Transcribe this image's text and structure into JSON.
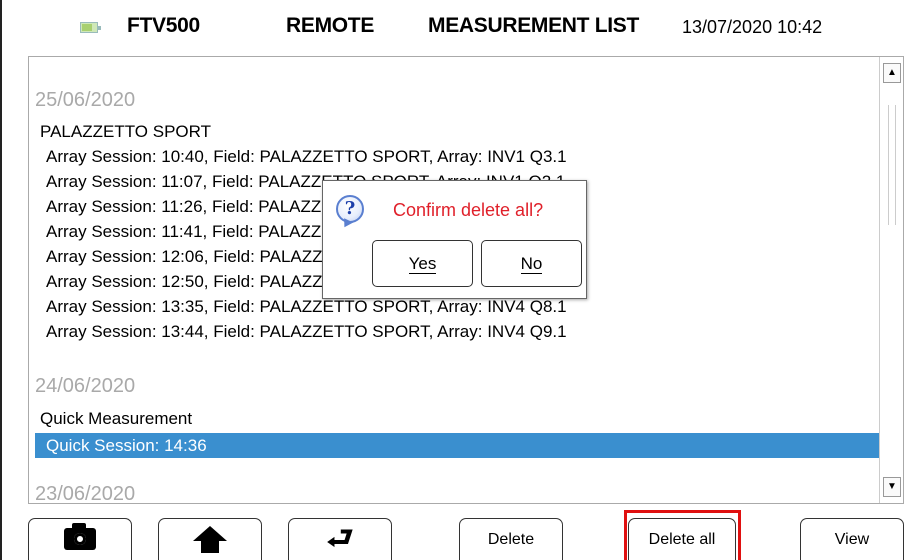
{
  "header": {
    "battery_icon": "battery-icon",
    "device": "FTV500",
    "mode": "REMOTE",
    "title": "MEASUREMENT LIST",
    "datetime": "13/07/2020 10:42"
  },
  "list": {
    "date1": "25/06/2020",
    "group1": "PALAZZETTO SPORT",
    "items1": [
      "Array Session: 10:40, Field: PALAZZETTO SPORT, Array: INV1 Q3.1",
      "Array Session: 11:07, Field: PALAZZETTO SPORT, Array: INV1 Q2.1",
      "Array Session: 11:26, Field: PALAZZETTO SPORT, Array: INV2 Q4.1",
      "Array Session: 11:41, Field: PALAZZETTO SPORT, Array: INV2 Q5.1",
      "Array Session: 12:06, Field: PALAZZETTO SPORT, Array: INV3 Q6.1",
      "Array Session: 12:50, Field: PALAZZETTO SPORT, Array: INV3 Q7.1",
      "Array Session: 13:35, Field: PALAZZETTO SPORT, Array: INV4 Q8.1",
      "Array Session: 13:44, Field: PALAZZETTO SPORT, Array: INV4 Q9.1"
    ],
    "date2": "24/06/2020",
    "group2": "Quick Measurement",
    "selected_item": "Quick Session: 14:36",
    "date3": "23/06/2020"
  },
  "dialog": {
    "icon": "question-icon",
    "message": "Confirm delete all?",
    "yes_label": "Yes",
    "no_label": "No"
  },
  "toolbar": {
    "camera_icon": "camera-icon",
    "home_icon": "home-icon",
    "back_icon": "back-arrow-icon",
    "delete_label": "Delete",
    "delete_all_label": "Delete all",
    "view_label": "View"
  },
  "colors": {
    "selection": "#3a8fcf",
    "dialog_text": "#e0202a",
    "highlight_border": "#e01010",
    "date_text": "#a9a9a9"
  }
}
